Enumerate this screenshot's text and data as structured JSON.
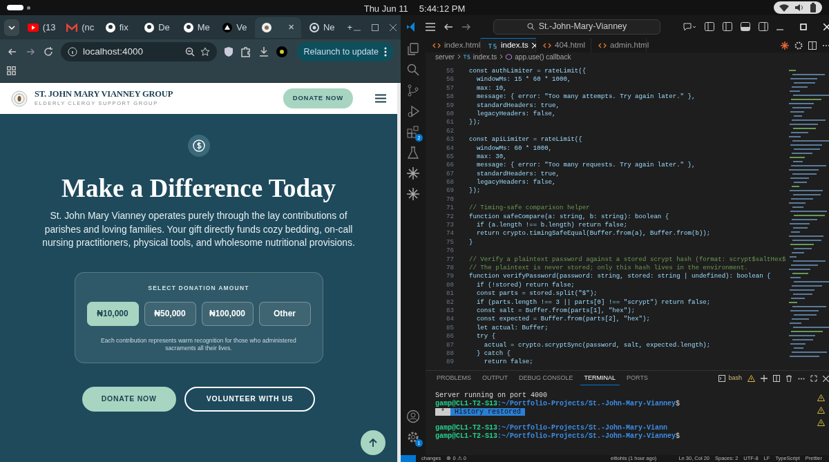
{
  "top_bar": {
    "date": "Thu Jun 11",
    "time": "5:44:12 PM"
  },
  "browser": {
    "tabs": [
      {
        "kind": "youtube",
        "label": "(13",
        "selected": false
      },
      {
        "kind": "gmail",
        "label": "(nc",
        "selected": false
      },
      {
        "kind": "github",
        "label": "fix",
        "selected": false
      },
      {
        "kind": "github",
        "label": "De",
        "selected": false
      },
      {
        "kind": "github",
        "label": "Me",
        "selected": false
      },
      {
        "kind": "triangle",
        "label": "Ve",
        "selected": false
      },
      {
        "kind": "seal",
        "close": "×",
        "selected": true
      },
      {
        "kind": "chrome",
        "label": "Ne",
        "selected": false
      }
    ],
    "new_tab": "+",
    "address": "localhost:4000",
    "relaunch": "Relaunch to update"
  },
  "site": {
    "brand": "ST. JOHN MARY VIANNEY GROUP",
    "tagline": "ELDERLY CLERGY SUPPORT GROUP",
    "header_button": "DONATE NOW",
    "heading": "Make a Difference Today",
    "intro": "St. John Mary Vianney operates purely through the lay contributions of parishes and loving families. Your gift directly funds cozy bedding, on-call nursing practitioners, physical tools, and wholesome nutritional provisions.",
    "donation": {
      "title": "SELECT DONATION AMOUNT",
      "amounts": [
        {
          "label": "₦10,000",
          "selected": true
        },
        {
          "label": "₦50,000",
          "selected": false
        },
        {
          "label": "₦100,000",
          "selected": false
        },
        {
          "label": "Other",
          "selected": false
        }
      ],
      "note": "Each contribution represents warm recognition for those who administered sacraments all their lives."
    },
    "buttons": [
      {
        "label": "DONATE NOW",
        "kind": "primary"
      },
      {
        "label": "VOLUNTEER WITH US",
        "kind": "outline"
      }
    ]
  },
  "editor": {
    "search": "St.-John-Mary-Vianney",
    "activity": [
      {
        "kind": "files"
      },
      {
        "kind": "search"
      },
      {
        "kind": "branch"
      },
      {
        "kind": "run"
      },
      {
        "kind": "extensions",
        "badge": "2"
      },
      {
        "kind": "flask"
      },
      {
        "kind": "sparkle"
      },
      {
        "kind": "sparkle"
      }
    ],
    "activity_bottom": [
      {
        "kind": "account"
      },
      {
        "kind": "gear",
        "badge": "1"
      }
    ],
    "tabs": [
      {
        "label": "index.html",
        "kind": "html",
        "selected": false
      },
      {
        "label": "index.ts",
        "kind": "ts",
        "selected": true
      },
      {
        "label": "404.html",
        "kind": "html",
        "selected": false
      },
      {
        "label": "admin.html",
        "kind": "html",
        "selected": false
      }
    ],
    "breadcrumb": [
      "server",
      "index.ts",
      "app.use() callback"
    ],
    "lines": [
      {
        "num": "55",
        "kind": "code",
        "text": "const authLimiter = rateLimit({"
      },
      {
        "num": "56",
        "kind": "code",
        "text": "  windowMs: 15 * 60 * 1000,"
      },
      {
        "num": "57",
        "kind": "code",
        "text": "  max: 10,"
      },
      {
        "num": "58",
        "kind": "code",
        "text": "  message: { error: \"Too many attempts. Try again later.\" },"
      },
      {
        "num": "59",
        "kind": "code",
        "text": "  standardHeaders: true,"
      },
      {
        "num": "60",
        "kind": "code",
        "text": "  legacyHeaders: false,"
      },
      {
        "num": "61",
        "kind": "code",
        "text": "});"
      },
      {
        "num": "62",
        "kind": "blank"
      },
      {
        "num": "63",
        "kind": "code",
        "text": "const apiLimiter = rateLimit({"
      },
      {
        "num": "64",
        "kind": "code",
        "text": "  windowMs: 60 * 1000,"
      },
      {
        "num": "65",
        "kind": "code",
        "text": "  max: 30,"
      },
      {
        "num": "66",
        "kind": "code",
        "text": "  message: { error: \"Too many requests. Try again later.\" },"
      },
      {
        "num": "67",
        "kind": "code",
        "text": "  standardHeaders: true,"
      },
      {
        "num": "68",
        "kind": "code",
        "text": "  legacyHeaders: false,"
      },
      {
        "num": "69",
        "kind": "code",
        "text": "});"
      },
      {
        "num": "70",
        "kind": "blank"
      },
      {
        "num": "71",
        "kind": "comment",
        "text": "// Timing-safe comparison helper"
      },
      {
        "num": "72",
        "kind": "code",
        "text": "function safeCompare(a: string, b: string): boolean {"
      },
      {
        "num": "73",
        "kind": "code",
        "text": "  if (a.length !== b.length) return false;"
      },
      {
        "num": "74",
        "kind": "code",
        "text": "  return crypto.timingSafeEqual(Buffer.from(a), Buffer.from(b));"
      },
      {
        "num": "75",
        "kind": "code",
        "text": "}"
      },
      {
        "num": "76",
        "kind": "blank"
      },
      {
        "num": "77",
        "kind": "comment",
        "text": "// Verify a plaintext password against a stored scrypt hash (format: scrypt$saltHex$"
      },
      {
        "num": "78",
        "kind": "comment",
        "text": "// The plaintext is never stored; only this hash lives in the environment."
      },
      {
        "num": "79",
        "kind": "code",
        "text": "function verifyPassword(password: string, stored: string | undefined): boolean {"
      },
      {
        "num": "80",
        "kind": "code",
        "text": "  if (!stored) return false;"
      },
      {
        "num": "81",
        "kind": "code",
        "text": "  const parts = stored.split(\"$\");"
      },
      {
        "num": "82",
        "kind": "code",
        "text": "  if (parts.length !== 3 || parts[0] !== \"scrypt\") return false;"
      },
      {
        "num": "83",
        "kind": "code",
        "text": "  const salt = Buffer.from(parts[1], \"hex\");"
      },
      {
        "num": "84",
        "kind": "code",
        "text": "  const expected = Buffer.from(parts[2], \"hex\");"
      },
      {
        "num": "85",
        "kind": "code",
        "text": "  let actual: Buffer;"
      },
      {
        "num": "86",
        "kind": "code",
        "text": "  try {"
      },
      {
        "num": "87",
        "kind": "code",
        "text": "    actual = crypto.scryptSync(password, salt, expected.length);"
      },
      {
        "num": "88",
        "kind": "code",
        "text": "  } catch {"
      },
      {
        "num": "89",
        "kind": "code",
        "text": "    return false;"
      }
    ],
    "panel_tabs": [
      {
        "label": "PROBLEMS",
        "selected": false
      },
      {
        "label": "OUTPUT",
        "selected": false
      },
      {
        "label": "DEBUG CONSOLE",
        "selected": false
      },
      {
        "label": "TERMINAL",
        "selected": true
      },
      {
        "label": "PORTS",
        "selected": false
      }
    ],
    "shell": "bash",
    "terminal": [
      {
        "kind": "output",
        "text": "Server running on port 4000"
      },
      {
        "kind": "prompt",
        "user": "gamp@CL1-T2-S13",
        "path": ":~/Portfolio-Projects/St.-John-Mary-Vianney",
        "end": "$"
      },
      {
        "kind": "notice",
        "mark": "*",
        "text": "History restored"
      },
      {
        "kind": "blank"
      },
      {
        "kind": "prompt",
        "user": "gamp@CL1-T2-S13",
        "path": ":~/Portfolio-Projects/St.-John-Mary-Viann"
      },
      {
        "kind": "prompt",
        "user": "gamp@CL1-T2-S13",
        "path": ":~/Portfolio-Projects/St.-John-Mary-Vianney",
        "end": "$"
      }
    ],
    "status": {
      "left": [
        "changes",
        "⊗ 0 ⚠ 0"
      ],
      "middle": "eitiohis (1 hour ago)",
      "right": [
        "Ln 30, Col 20",
        "Spaces: 2",
        "UTF-8",
        "LF",
        "TypeScript",
        "Prettier"
      ]
    }
  }
}
